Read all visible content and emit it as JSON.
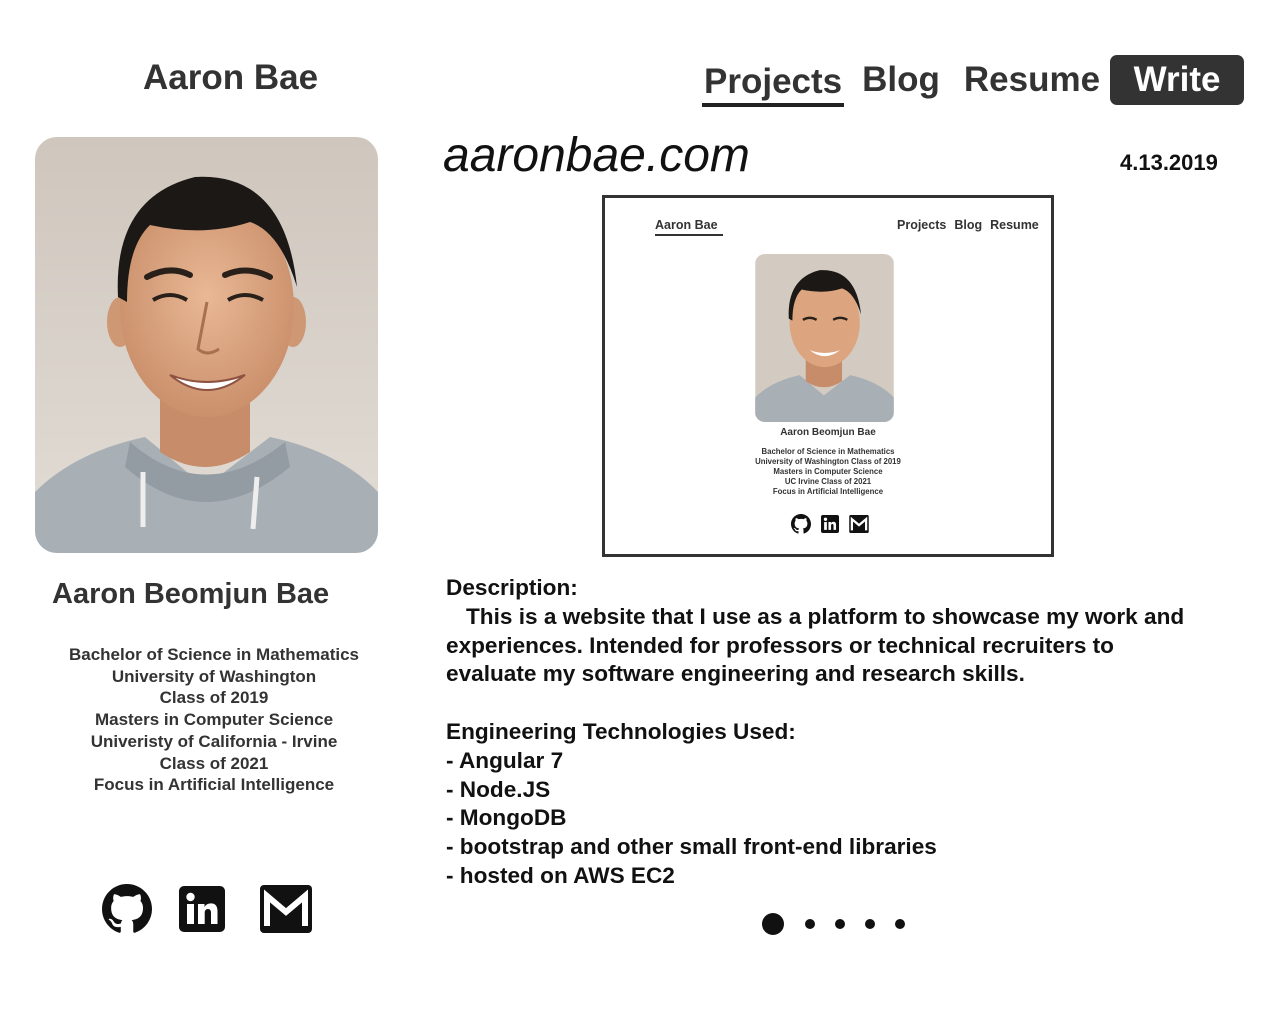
{
  "header": {
    "brand": "Aaron Bae",
    "nav": [
      {
        "label": "Projects",
        "active": true
      },
      {
        "label": "Blog"
      },
      {
        "label": "Resume"
      },
      {
        "label": "Write"
      }
    ]
  },
  "profile": {
    "name": "Aaron Beomjun Bae",
    "credentials": [
      "Bachelor of Science in Mathematics",
      "University of Washington",
      "Class of 2019",
      "Masters in Computer Science",
      "Univeristy of California - Irvine",
      "Class of 2021",
      "Focus in Artificial Intelligence"
    ],
    "socials": [
      "github-icon",
      "linkedin-icon",
      "gmail-icon"
    ]
  },
  "project": {
    "title": "aaronbae.com",
    "date": "4.13.2019",
    "preview": {
      "brand": "Aaron Bae",
      "nav": [
        "Projects",
        "Blog",
        "Resume"
      ],
      "name": "Aaron Beomjun Bae",
      "credentials": [
        "Bachelor of Science in Mathematics",
        "University of Washington Class of 2019",
        "Masters in Computer Science",
        "UC Irvine Class of 2021",
        "Focus in Artificial Intelligence"
      ]
    },
    "description_heading": "Description:",
    "description_lines": [
      "This is a website that I use as a platform to showcase my work and",
      "experiences. Intended for professors or technical recruiters to",
      "evaluate my software engineering and research skills."
    ],
    "tech_heading": "Engineering Technologies Used:",
    "technologies": [
      "- Angular 7",
      "- Node.JS",
      "- MongoDB",
      "- bootstrap and other small front-end libraries",
      "- hosted on AWS EC2"
    ]
  },
  "carousel": {
    "total": 5,
    "active_index": 0
  },
  "colors": {
    "text": "#333333",
    "accent": "#333333",
    "background": "#ffffff"
  }
}
